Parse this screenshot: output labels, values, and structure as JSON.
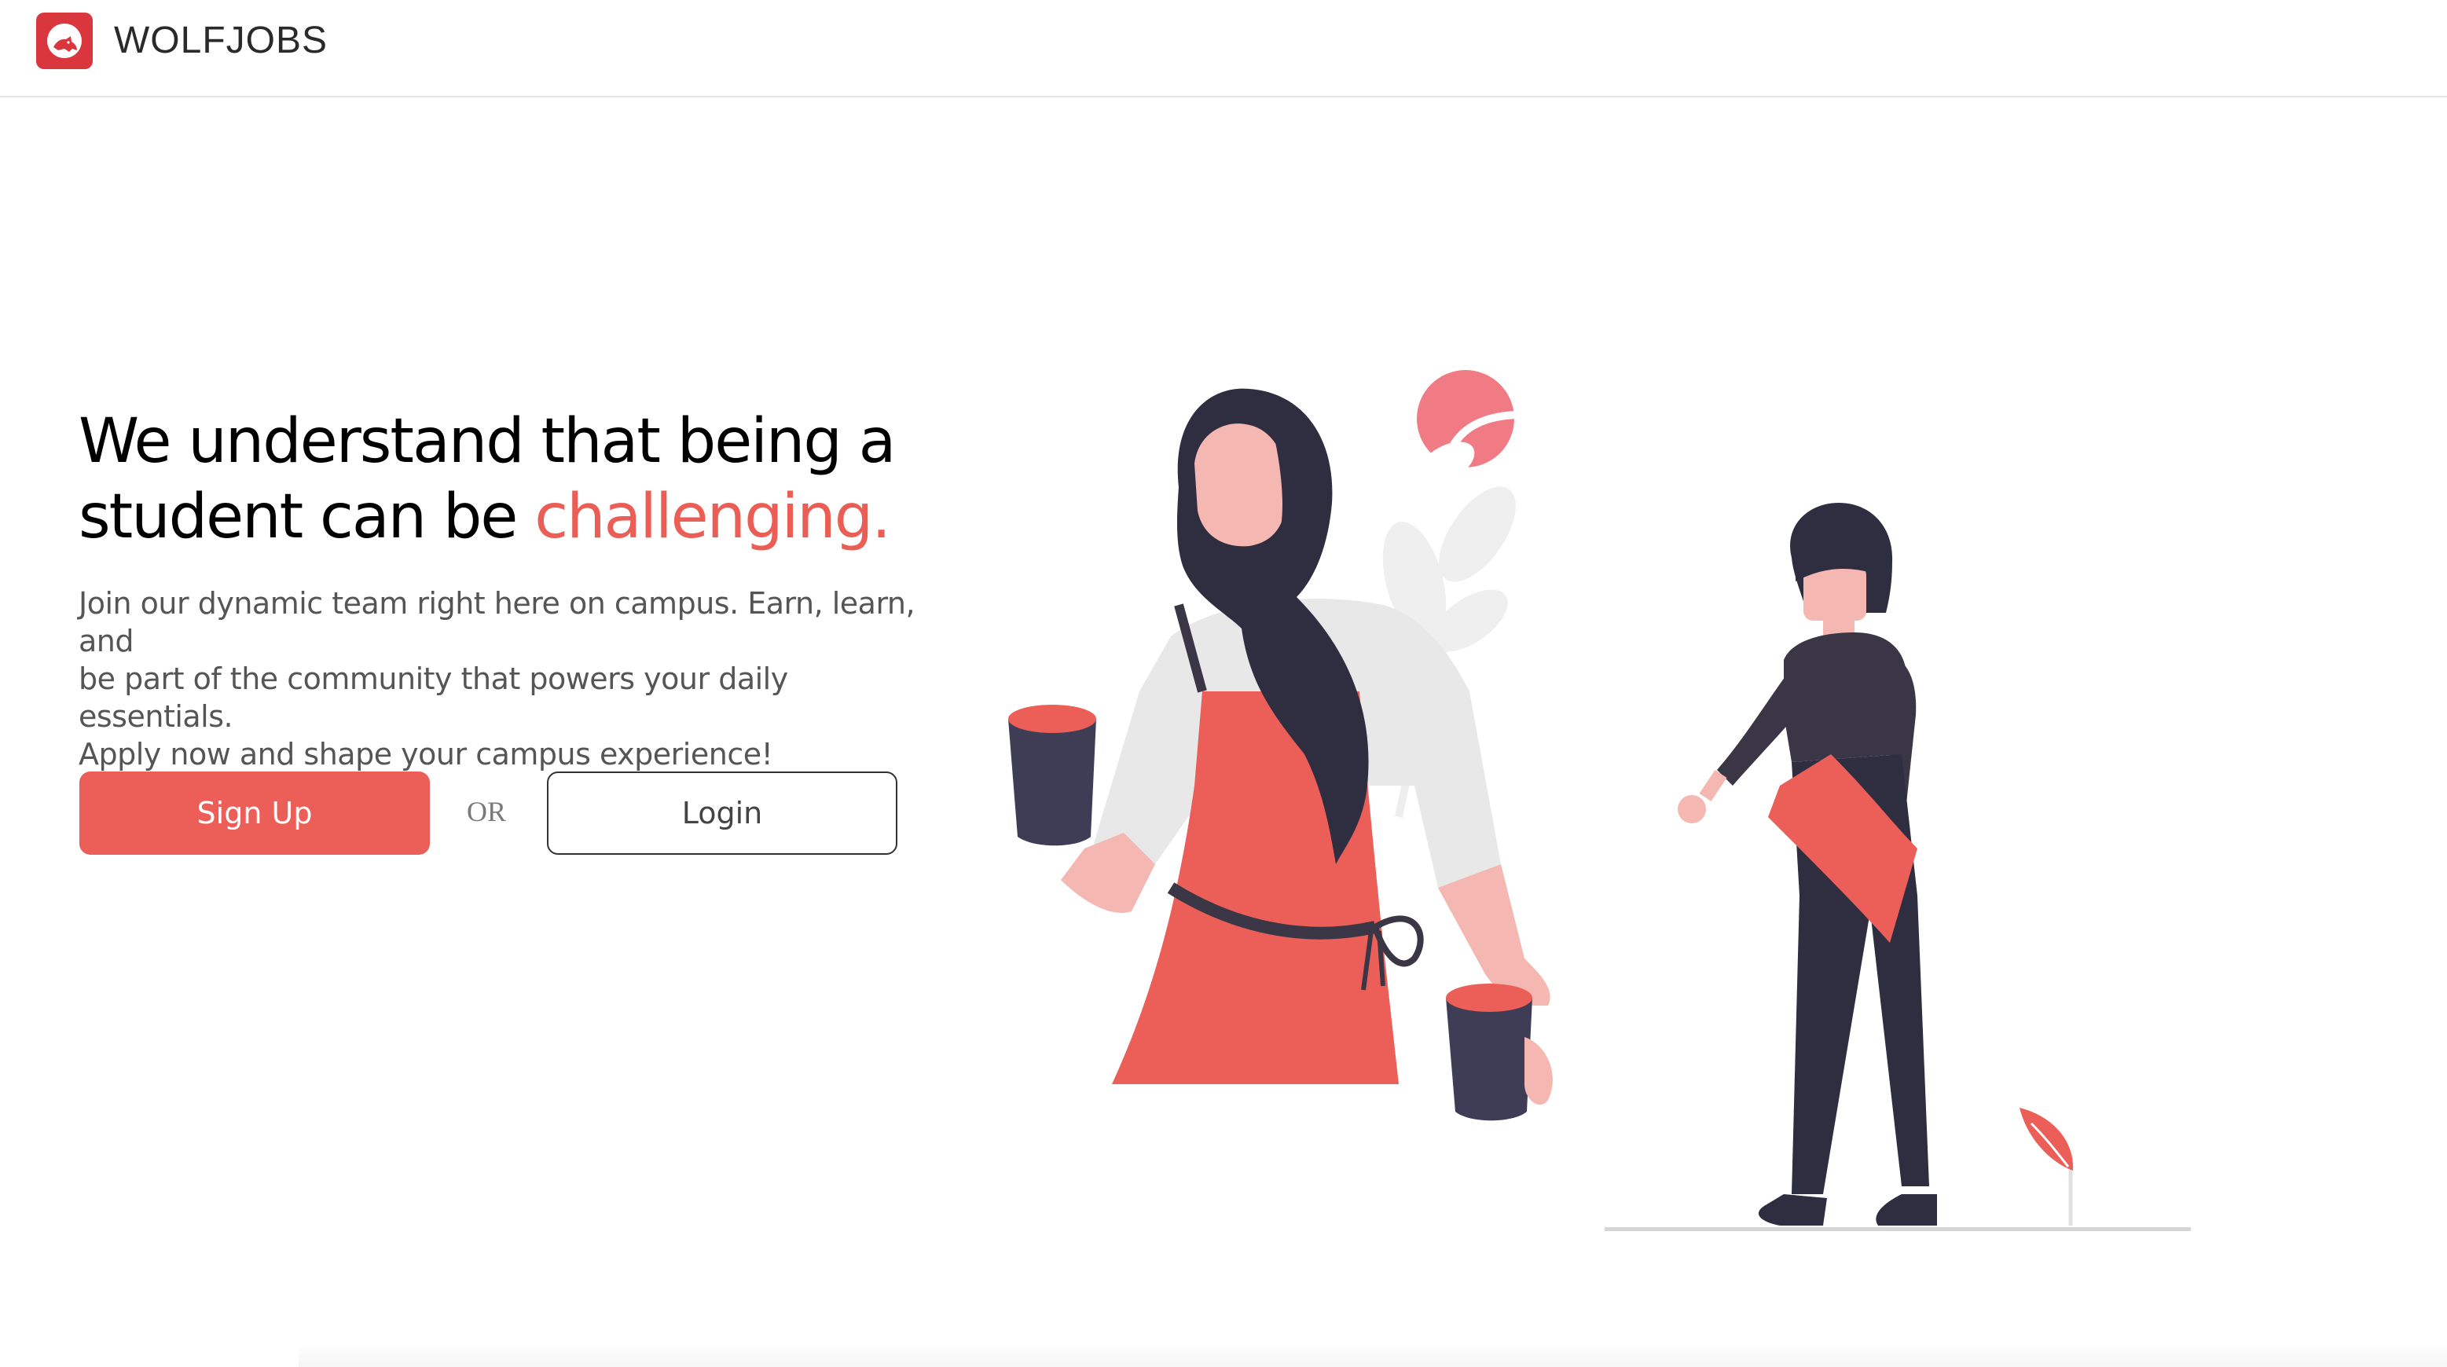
{
  "header": {
    "brand": "WOLFJOBS",
    "logo_icon": "wolf-logo-icon"
  },
  "hero": {
    "headline_line1": "We understand that being a",
    "headline_line2_prefix": "student can be ",
    "headline_accent": "challenging.",
    "subtext_line1": "Join our dynamic team right here on campus. Earn, learn, and",
    "subtext_line2": "be part of the community that powers your daily essentials.",
    "subtext_line3": "Apply now and shape your campus experience!"
  },
  "actions": {
    "signup_label": "Sign Up",
    "or_label": "OR",
    "login_label": "Login"
  },
  "illustration": {
    "icon": "barista-and-customer-illustration"
  },
  "colors": {
    "accent": "#eb5e55",
    "logo": "#d9363e",
    "dark": "#3a3645",
    "skin": "#f5b7b1"
  }
}
